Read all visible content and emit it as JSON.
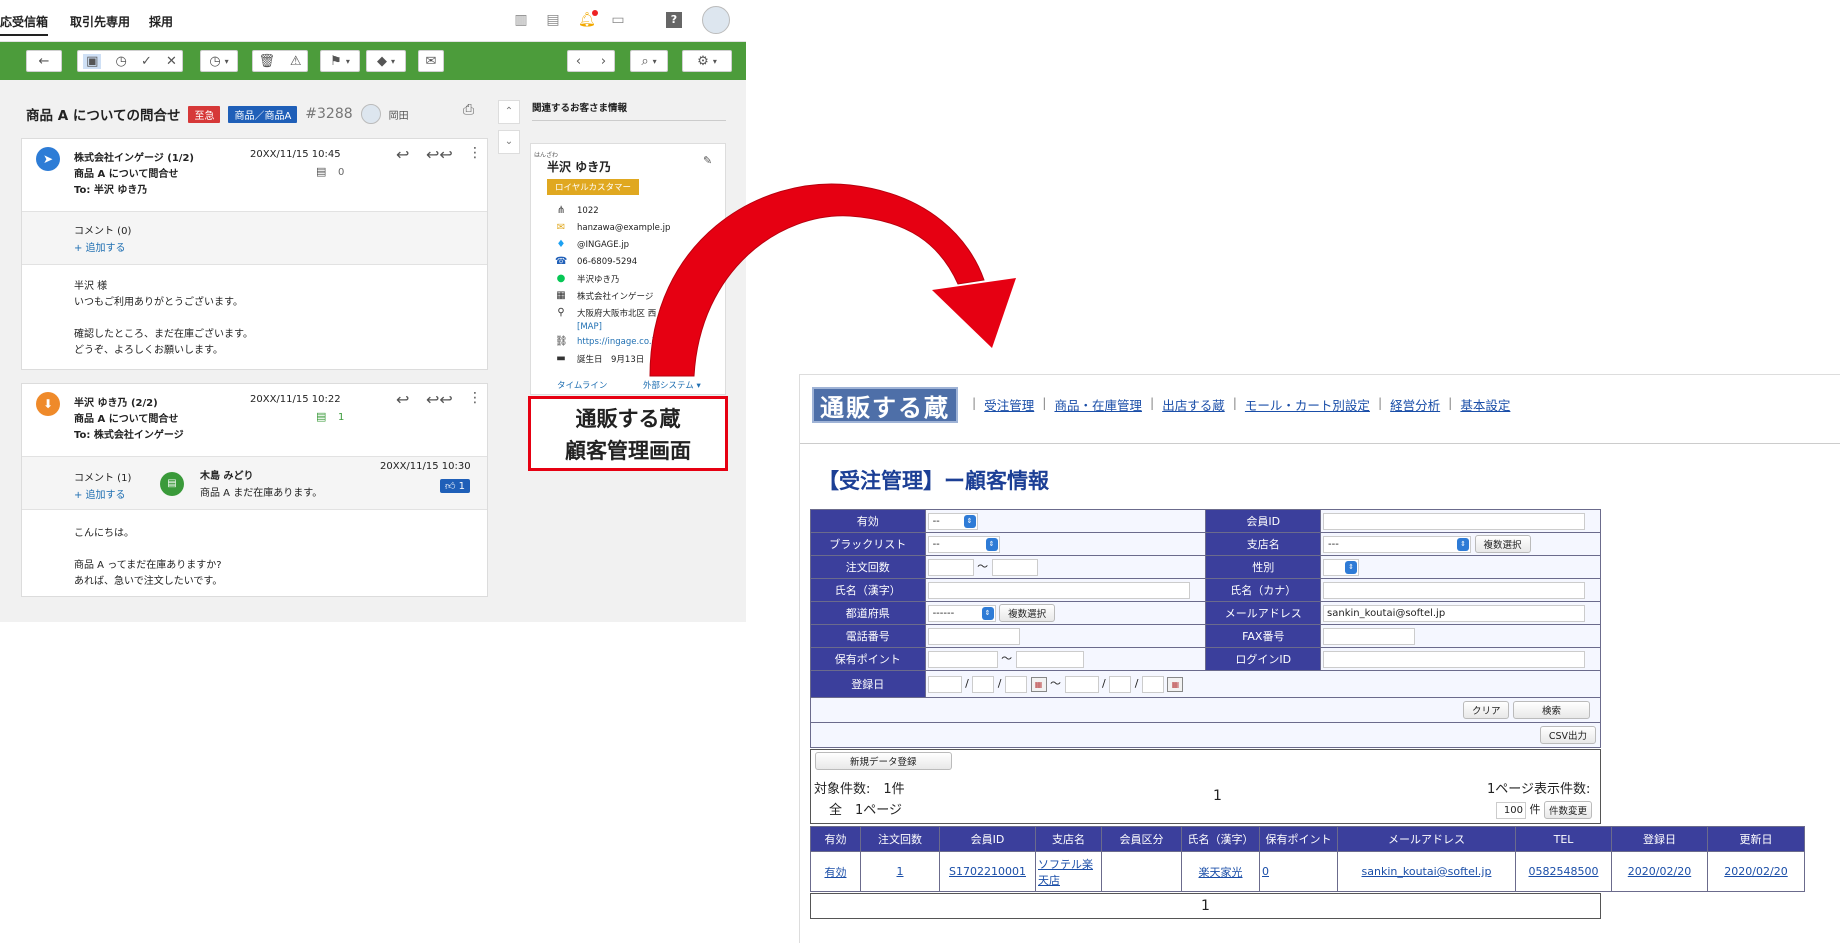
{
  "header": {
    "tabs": [
      "応受信箱",
      "取引先専用",
      "採用"
    ]
  },
  "ticket": {
    "subject": "商品 A についての問合せ",
    "badge_urgent": "至急",
    "badge_category": "商品／商品A",
    "number": "#3288",
    "assignee": "岡田"
  },
  "messages": [
    {
      "from": "株式会社インゲージ (1/2)",
      "date": "20XX/11/15 10:45",
      "subject": "商品 A について問合せ",
      "to": "To: 半沢 ゆき乃",
      "comment_count": "0",
      "comments_label": "コメント (0)",
      "add_label": "+ 追加する",
      "body": [
        "半沢 様",
        "いつもご利用ありがとうございます。",
        "",
        "確認したところ、まだ在庫ございます。",
        "どうぞ、よろしくお願いします。"
      ]
    },
    {
      "from": "半沢 ゆき乃 (2/2)",
      "date": "20XX/11/15 10:22",
      "subject": "商品 A について問合せ",
      "to": "To: 株式会社インゲージ",
      "comment_count": "1",
      "comments_label": "コメント (1)",
      "add_label": "+ 追加する",
      "commenter": "木島 みどり",
      "comment_text": "商品 A まだ在庫あります。",
      "comment_date": "20XX/11/15 10:30",
      "like_count": "1",
      "body": [
        "こんにちは。",
        "",
        "商品 A ってまだ在庫ありますか?",
        "あれば、急いで注文したいです。"
      ]
    }
  ],
  "customer": {
    "section_title": "関連するお客さま情報",
    "furigana": "はんざわ",
    "name": "半沢 ゆき乃",
    "tag": "ロイヤルカスタマー",
    "rows": [
      {
        "icon": "org-icon",
        "text": "1022"
      },
      {
        "icon": "mail-icon",
        "text": "hanzawa@example.jp"
      },
      {
        "icon": "twitter-icon",
        "text": "@INGAGE.jp"
      },
      {
        "icon": "phone-icon",
        "text": "06-6809-5294"
      },
      {
        "icon": "line-icon",
        "text": "半沢ゆき乃"
      },
      {
        "icon": "building-icon",
        "text": "株式会社インゲージ"
      },
      {
        "icon": "pin-icon",
        "text": "大阪府大阪市北区 西"
      },
      {
        "icon": "none",
        "text": "[MAP]"
      },
      {
        "icon": "link-icon",
        "text": "https://ingage.co.jp"
      },
      {
        "icon": "doc-icon",
        "text": "誕生日　9月13日"
      }
    ],
    "tab_timeline": "タイムライン",
    "tab_external": "外部システム ▾"
  },
  "callout": {
    "line1": "通販する蔵",
    "line2": "顧客管理画面"
  },
  "kura": {
    "logo": "通販する蔵",
    "nav": [
      "受注管理",
      "商品・在庫管理",
      "出店する蔵",
      "モール・カート別設定",
      "経営分析",
      "基本設定"
    ],
    "title": "【受注管理】ー顧客情報",
    "labels": {
      "yuko": "有効",
      "member_id": "会員ID",
      "blacklist": "ブラックリスト",
      "branch": "支店名",
      "order_count": "注文回数",
      "gender": "性別",
      "name_kanji": "氏名（漢字）",
      "name_kana": "氏名（カナ）",
      "pref": "都道府県",
      "email": "メールアドレス",
      "tel": "電話番号",
      "fax": "FAX番号",
      "points": "保有ポイント",
      "login_id": "ログインID",
      "reg_date": "登録日"
    },
    "values": {
      "yuko_sel": "--",
      "blacklist_sel": "--",
      "branch_sel": "---",
      "pref_sel": "------",
      "email": "sankin_koutai@softel.jp",
      "tilde": "〜",
      "slash": "/"
    },
    "buttons": {
      "multi1": "複数選択",
      "multi2": "複数選択",
      "clear": "クリア",
      "search": "検索",
      "csv": "CSV出力",
      "new": "新規データ登録",
      "per_page_change": "件数変更"
    },
    "summary": {
      "count_label": "対象件数:　1件",
      "pages_label": "全　1ページ",
      "page_num": "1",
      "per_page_label": "1ページ表示件数:",
      "per_page_value": "100",
      "per_page_unit": "件"
    },
    "results": {
      "headers": [
        "有効",
        "注文回数",
        "会員ID",
        "支店名",
        "会員区分",
        "氏名（漢字）",
        "保有ポイント",
        "メールアドレス",
        "TEL",
        "登録日",
        "更新日"
      ],
      "rows": [
        [
          "有効",
          "1",
          "S1702210001",
          "ソフテル楽天店",
          "",
          "楽天家光",
          "0",
          "sankin_koutai@softel.jp",
          "0582548500",
          "2020/02/20",
          "2020/02/20"
        ]
      ],
      "footer_page": "1"
    }
  }
}
